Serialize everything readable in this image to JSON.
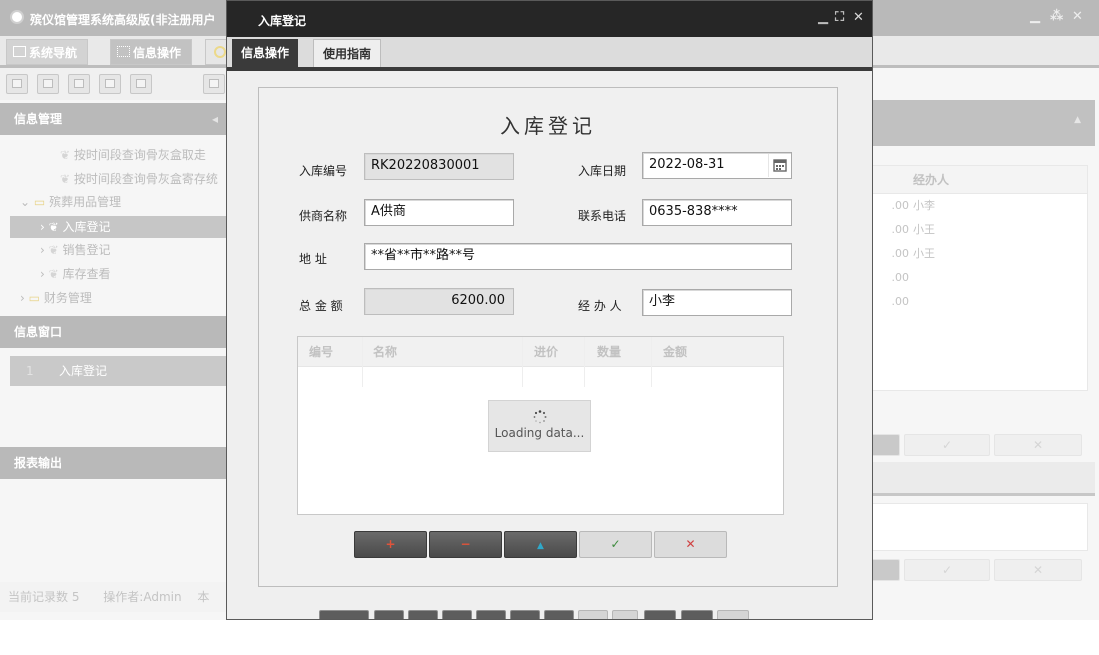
{
  "background_app": {
    "title": "殡仪馆管理系统高级版(非注册用户",
    "tabs": [
      {
        "label": "系统导航"
      },
      {
        "label": "信息操作"
      }
    ],
    "sidebar": {
      "section_info_mgmt": "信息管理",
      "tree": [
        {
          "label": "按时间段查询骨灰盒取走"
        },
        {
          "label": "按时间段查询骨灰盒寄存统"
        },
        {
          "label": "殡葬用品管理"
        },
        {
          "label": "入库登记"
        },
        {
          "label": "销售登记"
        },
        {
          "label": "库存查看"
        },
        {
          "label": "财务管理"
        }
      ],
      "section_info_window": "信息窗口",
      "window_item_index": "1",
      "window_item_label": "入库登记",
      "section_report": "报表输出"
    },
    "status_bar": {
      "record_count": "当前记录数 5",
      "operator": "操作者:Admin",
      "extra": "本"
    },
    "right_grid": {
      "header": "经办人",
      "rows": [
        {
          "amount": ".00",
          "handler": "小李"
        },
        {
          "amount": ".00",
          "handler": "小王"
        },
        {
          "amount": ".00",
          "handler": "小王"
        },
        {
          "amount": ".00",
          "handler": ""
        },
        {
          "amount": ".00",
          "handler": ""
        }
      ]
    },
    "right_buttons": {
      "confirm": "✓",
      "cancel": "✕"
    }
  },
  "dialog": {
    "title": "入库登记",
    "tabs": [
      {
        "label": "信息操作"
      },
      {
        "label": "使用指南"
      }
    ],
    "form": {
      "heading": "入库登记",
      "fields": {
        "entry_no": {
          "label": "入库编号",
          "value": "RK20220830001"
        },
        "entry_date": {
          "label": "入库日期",
          "value": "2022-08-31"
        },
        "supplier": {
          "label": "供商名称",
          "value": "A供商"
        },
        "phone": {
          "label": "联系电话",
          "value": "0635-838****"
        },
        "address": {
          "label": "地 址",
          "value": "**省**市**路**号"
        },
        "total": {
          "label": "总 金 额",
          "value": "6200.00"
        },
        "handler": {
          "label": "经 办 人",
          "value": "小李"
        }
      },
      "grid": {
        "columns": [
          "编号",
          "名称",
          "进价",
          "数量",
          "金额"
        ],
        "loading_text": "Loading data..."
      },
      "actions": {
        "add": "+",
        "remove": "−",
        "up": "▲",
        "confirm": "✓",
        "cancel": "✕"
      }
    }
  },
  "colors": {
    "dialog_title_bg": "#262626",
    "active_tab_bg": "#3a3a3a",
    "add_icon": "#e0533a",
    "remove_icon": "#e0533a",
    "up_icon": "#2fa8c9",
    "confirm_icon": "#3d8b3d",
    "cancel_icon": "#d04040"
  }
}
